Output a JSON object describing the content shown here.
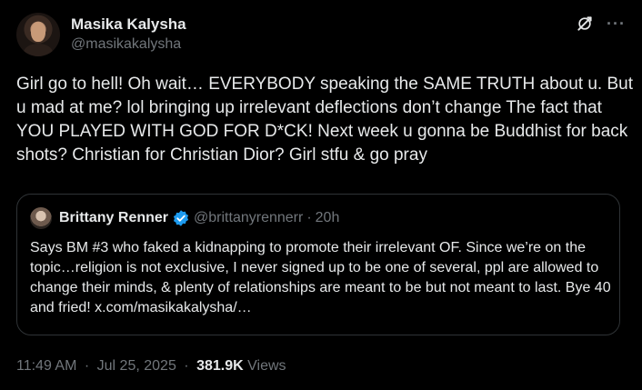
{
  "author": {
    "display_name": "Masika Kalysha",
    "handle": "@masikakalysha",
    "avatar_icon": "user-avatar"
  },
  "header_icons": {
    "grok": "grok-icon",
    "more": "···"
  },
  "tweet": {
    "text": "Girl go to hell! Oh wait… EVERYBODY speaking the SAME TRUTH about u. But u mad at me? lol bringing up irrelevant deflections don’t change The fact that YOU PLAYED WITH GOD FOR D*CK! Next week u gonna be Buddhist for back shots? Christian for Christian Dior? Girl stfu & go pray"
  },
  "quote": {
    "display_name": "Brittany Renner",
    "handle": "@brittanyrennerr",
    "separator": "·",
    "time": "20h",
    "text": "Says BM #3 who faked a kidnapping to promote their irrelevant OF. Since we’re on the topic…religion is not exclusive, I never signed up to be one of several, ppl are allowed to change their minds, & plenty of relationships are meant to be but not meant to last. Bye 40 and fried! x.com/masikakalysha/…",
    "verified_color": "#1d9bf0"
  },
  "meta": {
    "time": "11:49 AM",
    "separator": "·",
    "date": "Jul 25, 2025",
    "views_count": "381.9K",
    "views_label": "Views"
  },
  "colors": {
    "background": "#000000",
    "primary_text": "#e7e9ea",
    "secondary_text": "#71767b",
    "border": "#2f3336",
    "verified": "#1d9bf0"
  }
}
